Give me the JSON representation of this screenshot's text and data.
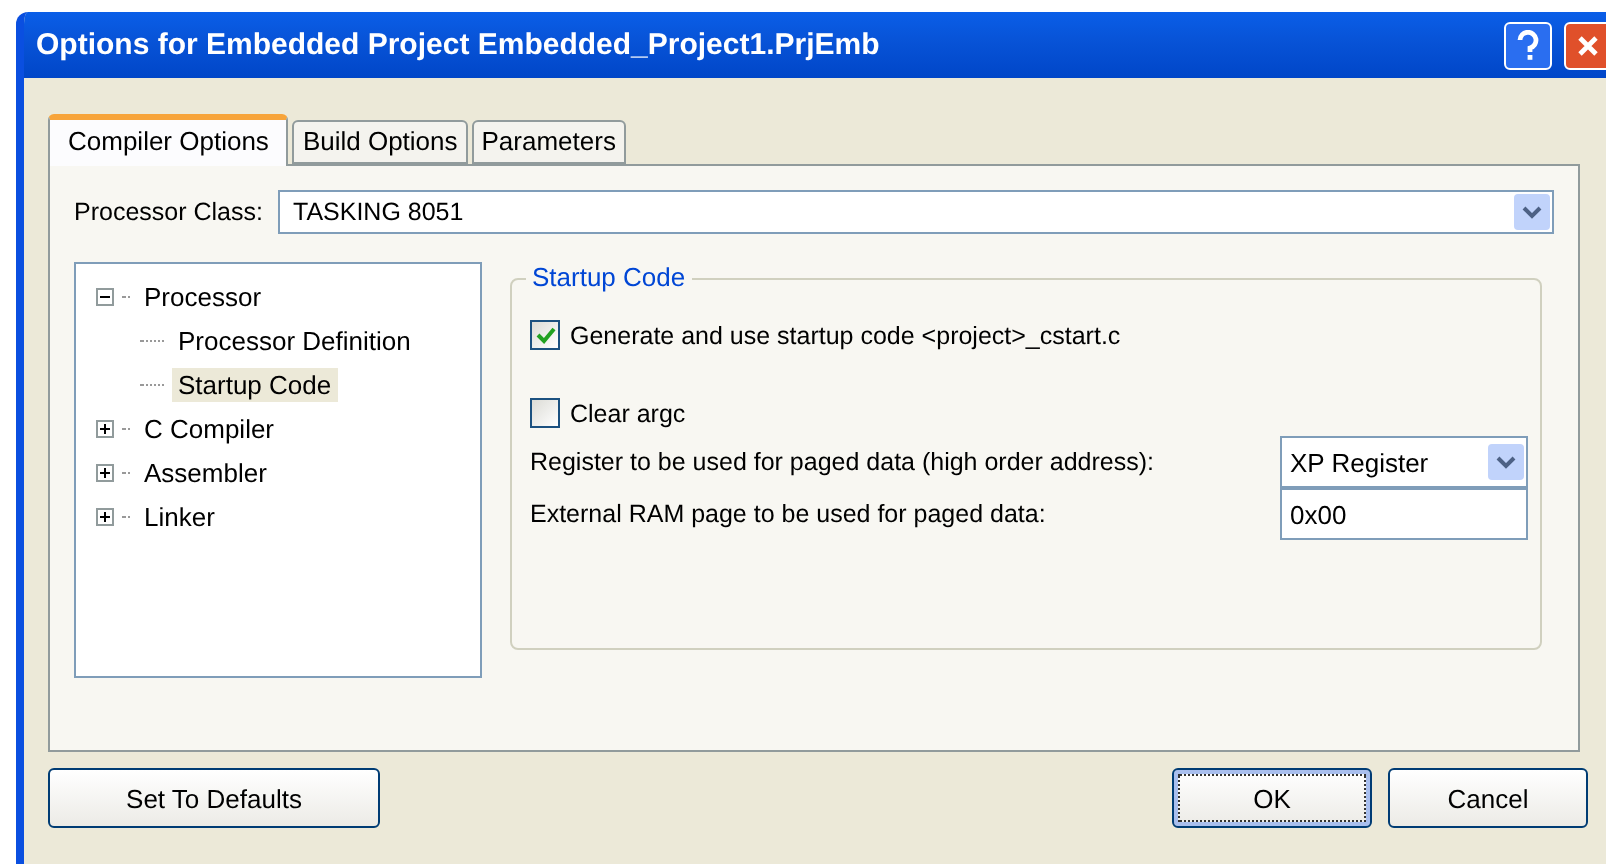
{
  "window": {
    "title": "Options for Embedded Project Embedded_Project1.PrjEmb"
  },
  "tabs": [
    {
      "label": "Compiler Options",
      "selected": true
    },
    {
      "label": "Build Options",
      "selected": false
    },
    {
      "label": "Parameters",
      "selected": false
    }
  ],
  "processor_class": {
    "label": "Processor Class:",
    "value": "TASKING 8051"
  },
  "tree": [
    {
      "label": "Processor",
      "expanded": true,
      "selected": false,
      "children": [
        {
          "label": "Processor Definition",
          "selected": false
        },
        {
          "label": "Startup Code",
          "selected": true
        }
      ]
    },
    {
      "label": "C Compiler",
      "expanded": false,
      "selected": false
    },
    {
      "label": "Assembler",
      "expanded": false,
      "selected": false
    },
    {
      "label": "Linker",
      "expanded": false,
      "selected": false
    }
  ],
  "group": {
    "title": "Startup Code",
    "checkboxes": [
      {
        "label": "Generate and use startup code <project>_cstart.c",
        "checked": true
      },
      {
        "label": "Clear argc",
        "checked": false
      }
    ],
    "fields": [
      {
        "kind": "select",
        "label": "Register to be used for paged data (high order address):",
        "value": "XP Register"
      },
      {
        "kind": "text",
        "label": "External RAM page to be used for paged data:",
        "value": "0x00"
      }
    ]
  },
  "buttons": {
    "defaults": "Set To Defaults",
    "ok": "OK",
    "cancel": "Cancel"
  }
}
